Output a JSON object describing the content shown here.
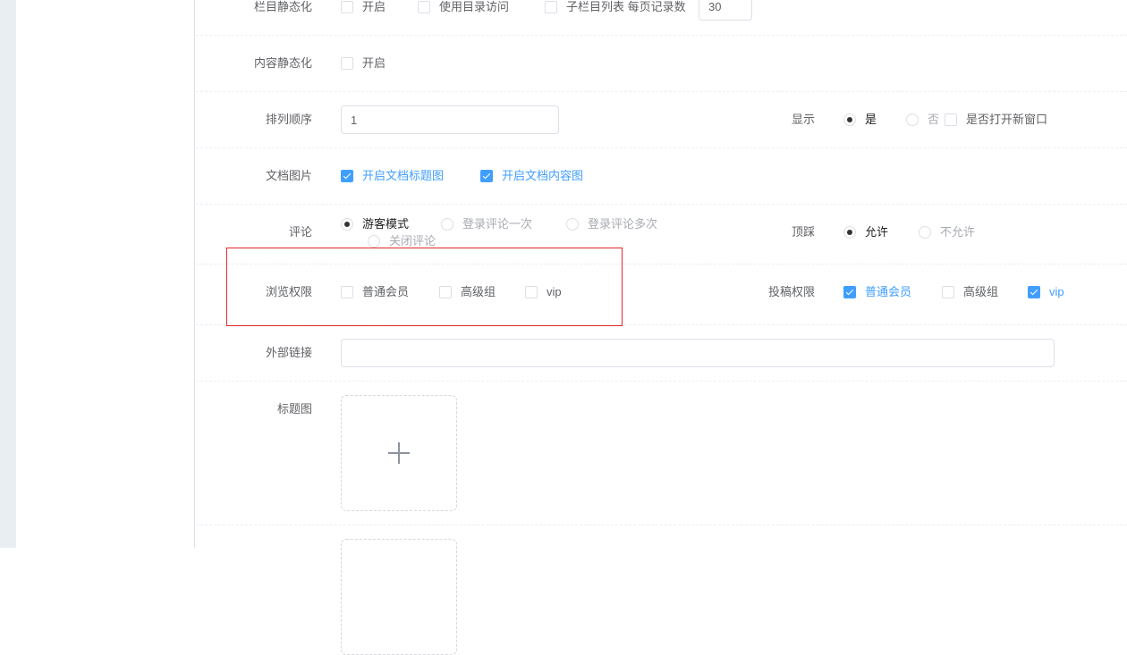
{
  "rows": {
    "column_static": {
      "label": "栏目静态化",
      "enable": "开启",
      "dir_access": "使用目录访问",
      "sub_list": "子栏目列表 每页记录数",
      "per_page": "30"
    },
    "content_static": {
      "label": "内容静态化",
      "enable": "开启"
    },
    "sort": {
      "label": "排列顺序",
      "value": "1"
    },
    "display": {
      "label": "显示",
      "yes": "是",
      "no": "否",
      "new_window": "是否打开新窗口"
    },
    "doc_images": {
      "label": "文档图片",
      "title_img": "开启文档标题图",
      "content_img": "开启文档内容图"
    },
    "comment": {
      "label": "评论",
      "options": [
        "游客模式",
        "登录评论一次",
        "登录评论多次",
        "关闭评论"
      ]
    },
    "vote": {
      "label": "顶踩",
      "allow": "允许",
      "deny": "不允许"
    },
    "browse_perm": {
      "label": "浏览权限",
      "options": [
        "普通会员",
        "高级组",
        "vip"
      ]
    },
    "submit_perm": {
      "label": "投稿权限",
      "options": [
        "普通会员",
        "高级组",
        "vip"
      ]
    },
    "external_link": {
      "label": "外部链接",
      "value": ""
    },
    "title_image": {
      "label": "标题图"
    }
  },
  "colors": {
    "accent": "#409eff",
    "highlight": "#e8262b"
  }
}
